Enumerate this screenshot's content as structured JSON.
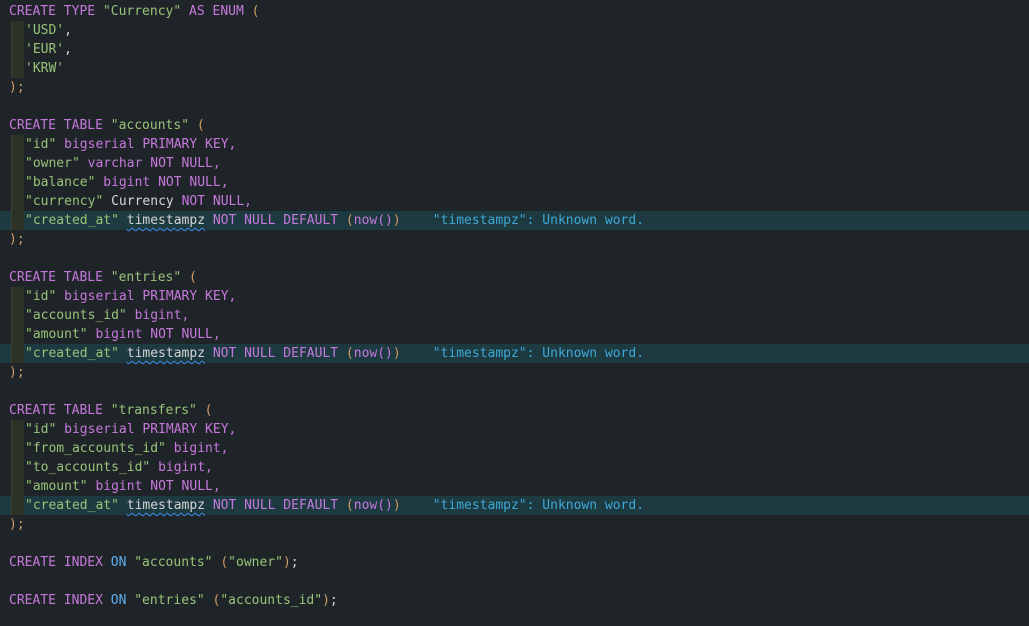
{
  "code": {
    "l1": {
      "kw1": "CREATE TYPE",
      "name": "\"Currency\"",
      "kw2": "AS ENUM",
      "open": "("
    },
    "l2": "'USD'",
    "l3": "'EUR'",
    "l4": "'KRW'",
    "close": ");",
    "accounts": {
      "header_kw": "CREATE TABLE",
      "name": "\"accounts\"",
      "cols": [
        {
          "name": "\"id\"",
          "type": "bigserial",
          "mod": "PRIMARY KEY,"
        },
        {
          "name": "\"owner\"",
          "type": "varchar",
          "mod": "NOT NULL,"
        },
        {
          "name": "\"balance\"",
          "type": "bigint",
          "mod": "NOT NULL,"
        },
        {
          "name": "\"currency\"",
          "type": "Currency",
          "mod": "NOT NULL,"
        },
        {
          "name": "\"created_at\"",
          "type": "timestampz",
          "mod": "NOT NULL DEFAULT",
          "fn": "now()",
          "diag": "\"timestampz\": Unknown word."
        }
      ]
    },
    "entries": {
      "header_kw": "CREATE TABLE",
      "name": "\"entries\"",
      "cols": [
        {
          "name": "\"id\"",
          "type": "bigserial",
          "mod": "PRIMARY KEY,"
        },
        {
          "name": "\"accounts_id\"",
          "type": "bigint,"
        },
        {
          "name": "\"amount\"",
          "type": "bigint",
          "mod": "NOT NULL,"
        },
        {
          "name": "\"created_at\"",
          "type": "timestampz",
          "mod": "NOT NULL DEFAULT",
          "fn": "now()",
          "diag": "\"timestampz\": Unknown word."
        }
      ]
    },
    "transfers": {
      "header_kw": "CREATE TABLE",
      "name": "\"transfers\"",
      "cols": [
        {
          "name": "\"id\"",
          "type": "bigserial",
          "mod": "PRIMARY KEY,"
        },
        {
          "name": "\"from_accounts_id\"",
          "type": "bigint,"
        },
        {
          "name": "\"to_accounts_id\"",
          "type": "bigint,"
        },
        {
          "name": "\"amount\"",
          "type": "bigint",
          "mod": "NOT NULL,"
        },
        {
          "name": "\"created_at\"",
          "type": "timestampz",
          "mod": "NOT NULL DEFAULT",
          "fn": "now()",
          "diag": "\"timestampz\": Unknown word."
        }
      ]
    },
    "index1": {
      "kw": "CREATE INDEX",
      "on": "ON",
      "table": "\"accounts\"",
      "col": "\"owner\""
    },
    "index2": {
      "kw": "CREATE INDEX",
      "on": "ON",
      "table": "\"entries\"",
      "col": "\"accounts_id\""
    }
  },
  "colors": {
    "background": "#1f2428",
    "highlight_line": "#1c3a40",
    "keyword": "#c678dd",
    "diagnostic": "#3fa7d6"
  }
}
